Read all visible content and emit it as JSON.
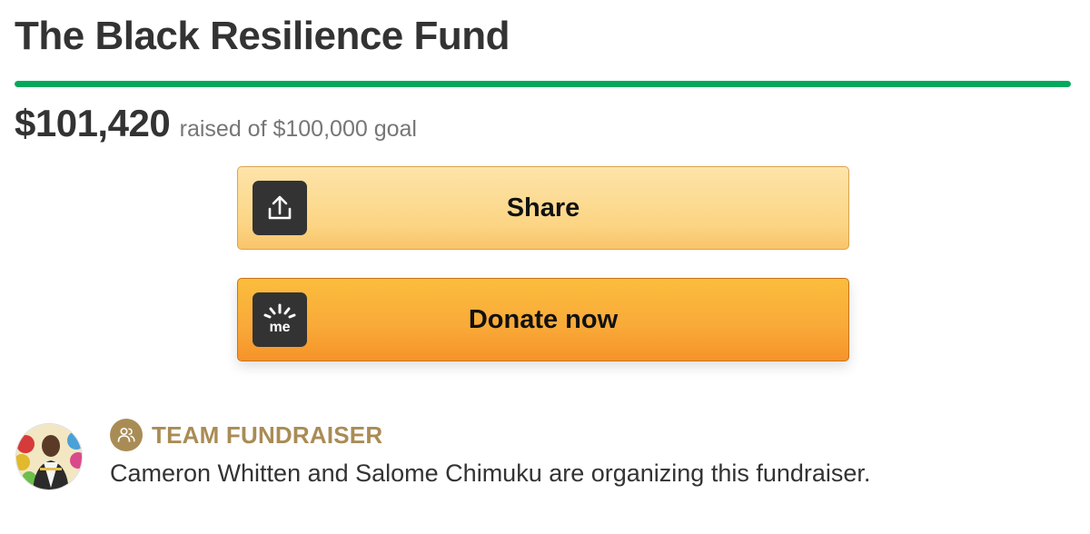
{
  "campaign": {
    "title": "The Black Resilience Fund",
    "raised_amount": "$101,420",
    "goal_text": "raised of $100,000 goal",
    "progress_fraction": 1.0
  },
  "buttons": {
    "share_label": "Share",
    "share_icon": "share-upload-icon",
    "donate_label": "Donate now",
    "donate_icon": "gofundme-logo-icon"
  },
  "team": {
    "label": "TEAM FUNDRAISER",
    "icon": "people-icon",
    "organizers_text": "Cameron Whitten and Salome Chimuku are organizing this fundraiser."
  },
  "colors": {
    "progress_green": "#02a95c",
    "share_button": "#fcd584",
    "donate_button": "#f9a938",
    "team_gold": "#a98c55",
    "icon_dark": "#333333"
  }
}
